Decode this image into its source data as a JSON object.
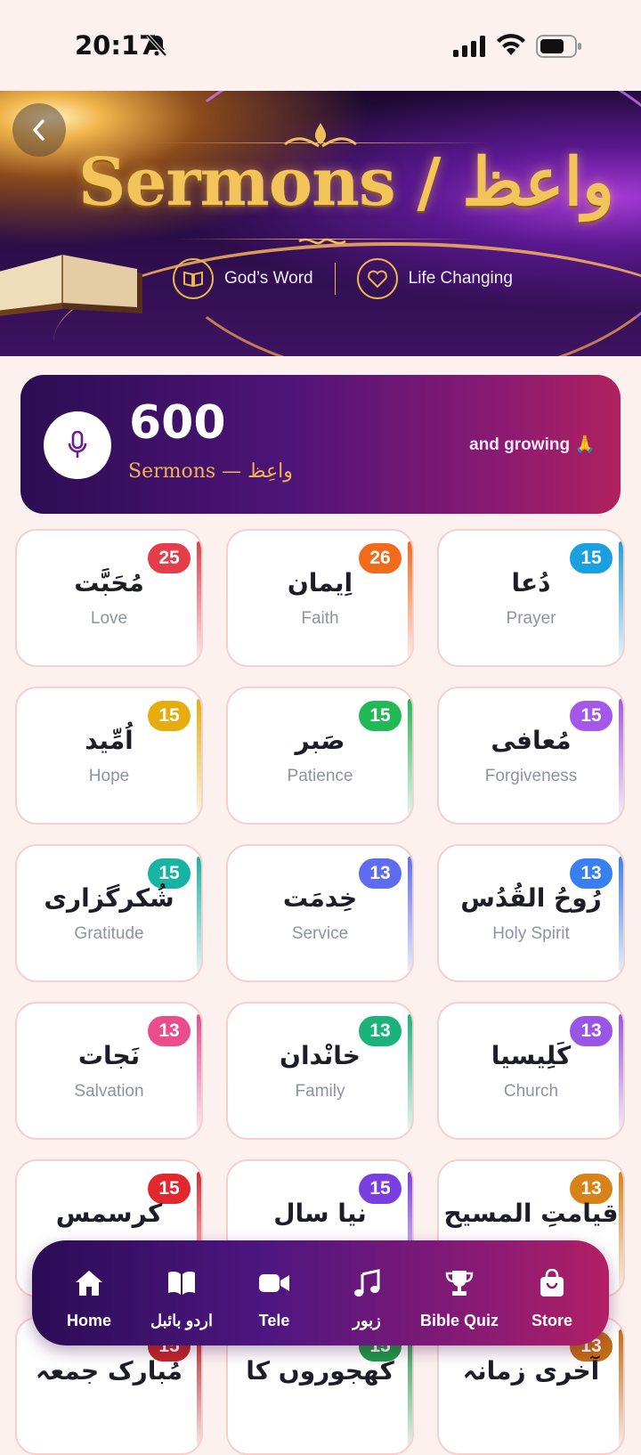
{
  "status": {
    "time": "20:17"
  },
  "banner": {
    "title": "Sermons / واعظ",
    "tag1": "God’s Word",
    "tag2": "Life Changing"
  },
  "stats": {
    "count": "600",
    "label": "Sermons — واعِظ",
    "growing": "and growing 🙏"
  },
  "categories": [
    {
      "urdu": "مُحَبَّت",
      "english": "Love",
      "count": "25",
      "color": "#e53e4a"
    },
    {
      "urdu": "اِیمان",
      "english": "Faith",
      "count": "26",
      "color": "#f26b1d"
    },
    {
      "urdu": "دُعا",
      "english": "Prayer",
      "count": "15",
      "color": "#1aa0e0"
    },
    {
      "urdu": "اُمِّید",
      "english": "Hope",
      "count": "15",
      "color": "#e7ad10"
    },
    {
      "urdu": "صَبر",
      "english": "Patience",
      "count": "15",
      "color": "#22b954"
    },
    {
      "urdu": "مُعافی",
      "english": "Forgiveness",
      "count": "15",
      "color": "#a457e8"
    },
    {
      "urdu": "شُکرگزاری",
      "english": "Gratitude",
      "count": "15",
      "color": "#17b4a4"
    },
    {
      "urdu": "خِدمَت",
      "english": "Service",
      "count": "13",
      "color": "#5e6df0"
    },
    {
      "urdu": "رُوحُ القُدُس",
      "english": "Holy Spirit",
      "count": "13",
      "color": "#3a7ff0"
    },
    {
      "urdu": "نَجات",
      "english": "Salvation",
      "count": "13",
      "color": "#ea4c8c"
    },
    {
      "urdu": "خانْدان",
      "english": "Family",
      "count": "13",
      "color": "#1cb37a"
    },
    {
      "urdu": "کَلِیسیا",
      "english": "Church",
      "count": "13",
      "color": "#9a55e6"
    },
    {
      "urdu": "کرسمس",
      "english": "",
      "count": "15",
      "color": "#e0282e"
    },
    {
      "urdu": "نیا سال",
      "english": "",
      "count": "15",
      "color": "#7a3fe0"
    },
    {
      "urdu": "قیامتِ المسیح",
      "english": "",
      "count": "13",
      "color": "#d9821a"
    },
    {
      "urdu": "مُبارک جمعہ",
      "english": "",
      "count": "15",
      "color": "#c0262c"
    },
    {
      "urdu": "کھجوروں کا",
      "english": "",
      "count": "15",
      "color": "#1f9a47"
    },
    {
      "urdu": "آخری زمانہ",
      "english": "",
      "count": "13",
      "color": "#c56b16"
    }
  ],
  "nav": {
    "items": [
      {
        "label": "Home",
        "icon": "home-icon"
      },
      {
        "label": "اردو بائبل",
        "icon": "book-icon"
      },
      {
        "label": "Tele",
        "icon": "video-icon"
      },
      {
        "label": "زبور",
        "icon": "music-icon"
      },
      {
        "label": "Bible Quiz",
        "icon": "trophy-icon"
      },
      {
        "label": "Store",
        "icon": "shopping-bag-icon"
      }
    ]
  }
}
